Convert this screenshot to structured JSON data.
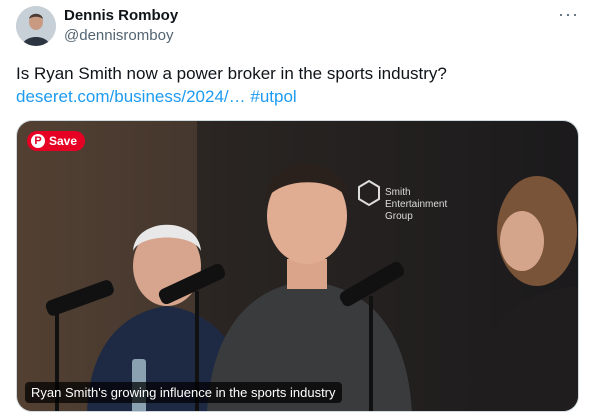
{
  "author": {
    "display_name": "Dennis Romboy",
    "handle": "@dennisromboy",
    "avatar": "avatar"
  },
  "more_icon": "···",
  "tweet": {
    "text": "Is Ryan Smith now a power broker in the sports industry?",
    "link_text": "deseret.com/business/2024/…",
    "hashtag": "#utpol"
  },
  "media": {
    "save_label": "Save",
    "save_icon": "pinterest-icon",
    "caption": "Ryan Smith's growing influence in the sports industry",
    "backdrop_logo": [
      "Smith",
      "Entertainment",
      "Group"
    ]
  },
  "colors": {
    "link": "#1d9bf0",
    "secondary_text": "#536471",
    "pinterest_red": "#e60023"
  }
}
